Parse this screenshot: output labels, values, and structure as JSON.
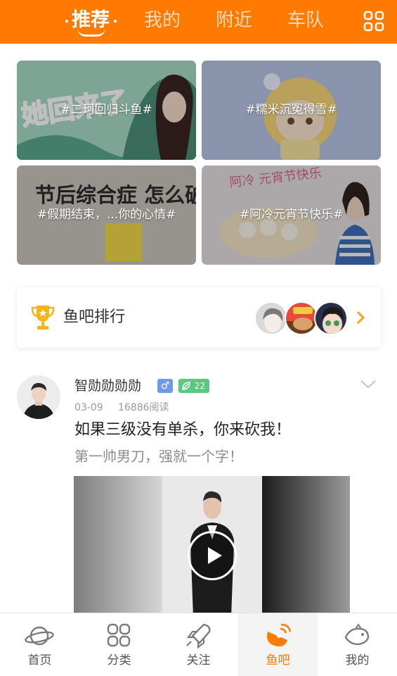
{
  "top_nav": {
    "tabs": [
      {
        "label": "推荐",
        "active": true
      },
      {
        "label": "我的",
        "active": false
      },
      {
        "label": "附近",
        "active": false
      },
      {
        "label": "车队",
        "active": false
      }
    ],
    "grid_icon": "grid-icon",
    "accent_color": "#ff7a00"
  },
  "topics": [
    {
      "label": "#二珂回归斗鱼#",
      "art_text": "她回来了"
    },
    {
      "label": "#糯米沉冤得雪#"
    },
    {
      "label": "#假期结束，...你的心情#",
      "art_text": "节后综合症 怎么破！"
    },
    {
      "label": "#阿冷元宵节快乐#",
      "art_text": "阿冷 元宵节快乐"
    }
  ],
  "ranking": {
    "icon": "trophy-icon",
    "title": "鱼吧排行",
    "chevron": "chevron-right-icon"
  },
  "post": {
    "username": "智勋勋勋勋",
    "gender": "♂",
    "level": "22",
    "date": "03-09",
    "reads": "16886阅读",
    "title": "如果三级没有单杀，你来砍我！",
    "subtitle": "第一帅男刀，强就一个字！",
    "menu_icon": "chevron-down-icon",
    "video_icon": "play-icon"
  },
  "bottom_nav": [
    {
      "label": "首页",
      "icon": "planet-icon",
      "active": false
    },
    {
      "label": "分类",
      "icon": "grid-icon",
      "active": false
    },
    {
      "label": "关注",
      "icon": "rocket-icon",
      "active": false
    },
    {
      "label": "鱼吧",
      "icon": "satellite-dish-icon",
      "active": true
    },
    {
      "label": "我的",
      "icon": "fish-icon",
      "active": false
    }
  ]
}
